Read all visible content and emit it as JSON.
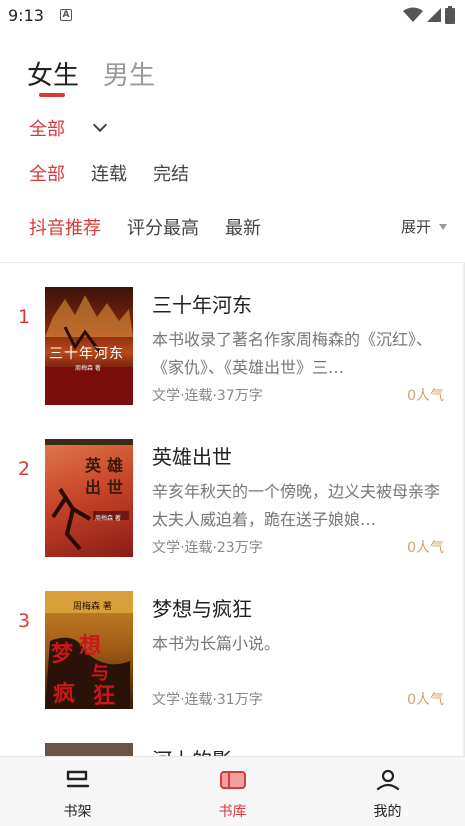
{
  "status_bar": {
    "time": "9:13",
    "notification_icon": "A",
    "icons": [
      "wifi-icon",
      "signal-icon",
      "battery-icon"
    ]
  },
  "gender_tabs": [
    {
      "label": "女生",
      "active": true
    },
    {
      "label": "男生",
      "active": false
    }
  ],
  "category": {
    "label": "全部"
  },
  "status_filters": [
    {
      "label": "全部",
      "active": true
    },
    {
      "label": "连载",
      "active": false
    },
    {
      "label": "完结",
      "active": false
    }
  ],
  "sort_filters": [
    {
      "label": "抖音推荐",
      "active": true
    },
    {
      "label": "评分最高",
      "active": false
    },
    {
      "label": "最新",
      "active": false
    }
  ],
  "expand_label": "展开",
  "books": [
    {
      "rank": "1",
      "title": "三十年河东",
      "description": "本书收录了著名作家周梅森的《沉红》、《家仇》、《英雄出世》三…",
      "meta": "文学·连载·37万字",
      "popularity": "0人气",
      "cover_title": "三十年河东",
      "cover_author": "周梅森 著"
    },
    {
      "rank": "2",
      "title": "英雄出世",
      "description": "辛亥年秋天的一个傍晚，边义夫被母亲李太夫人威迫着，跪在送子娘娘…",
      "meta": "文学·连载·23万字",
      "popularity": "0人气",
      "cover_title": "英雄出世",
      "cover_author": "周梅森 著"
    },
    {
      "rank": "3",
      "title": "梦想与疯狂",
      "description": "本书为长篇小说。",
      "meta": "文学·连载·31万字",
      "popularity": "0人气",
      "cover_title": "梦想与疯狂",
      "cover_author": "周梅森 著"
    },
    {
      "rank": "",
      "title": "河上的影",
      "description": "",
      "meta": "",
      "popularity": ""
    }
  ],
  "bottom_nav": [
    {
      "label": "书架",
      "icon": "bookshelf-icon",
      "active": false
    },
    {
      "label": "书库",
      "icon": "library-icon",
      "active": true
    },
    {
      "label": "我的",
      "icon": "profile-icon",
      "active": false
    }
  ],
  "colors": {
    "accent": "#d63b3b",
    "popularity": "#c9a36b",
    "nav_background": "#f7f7f7"
  }
}
